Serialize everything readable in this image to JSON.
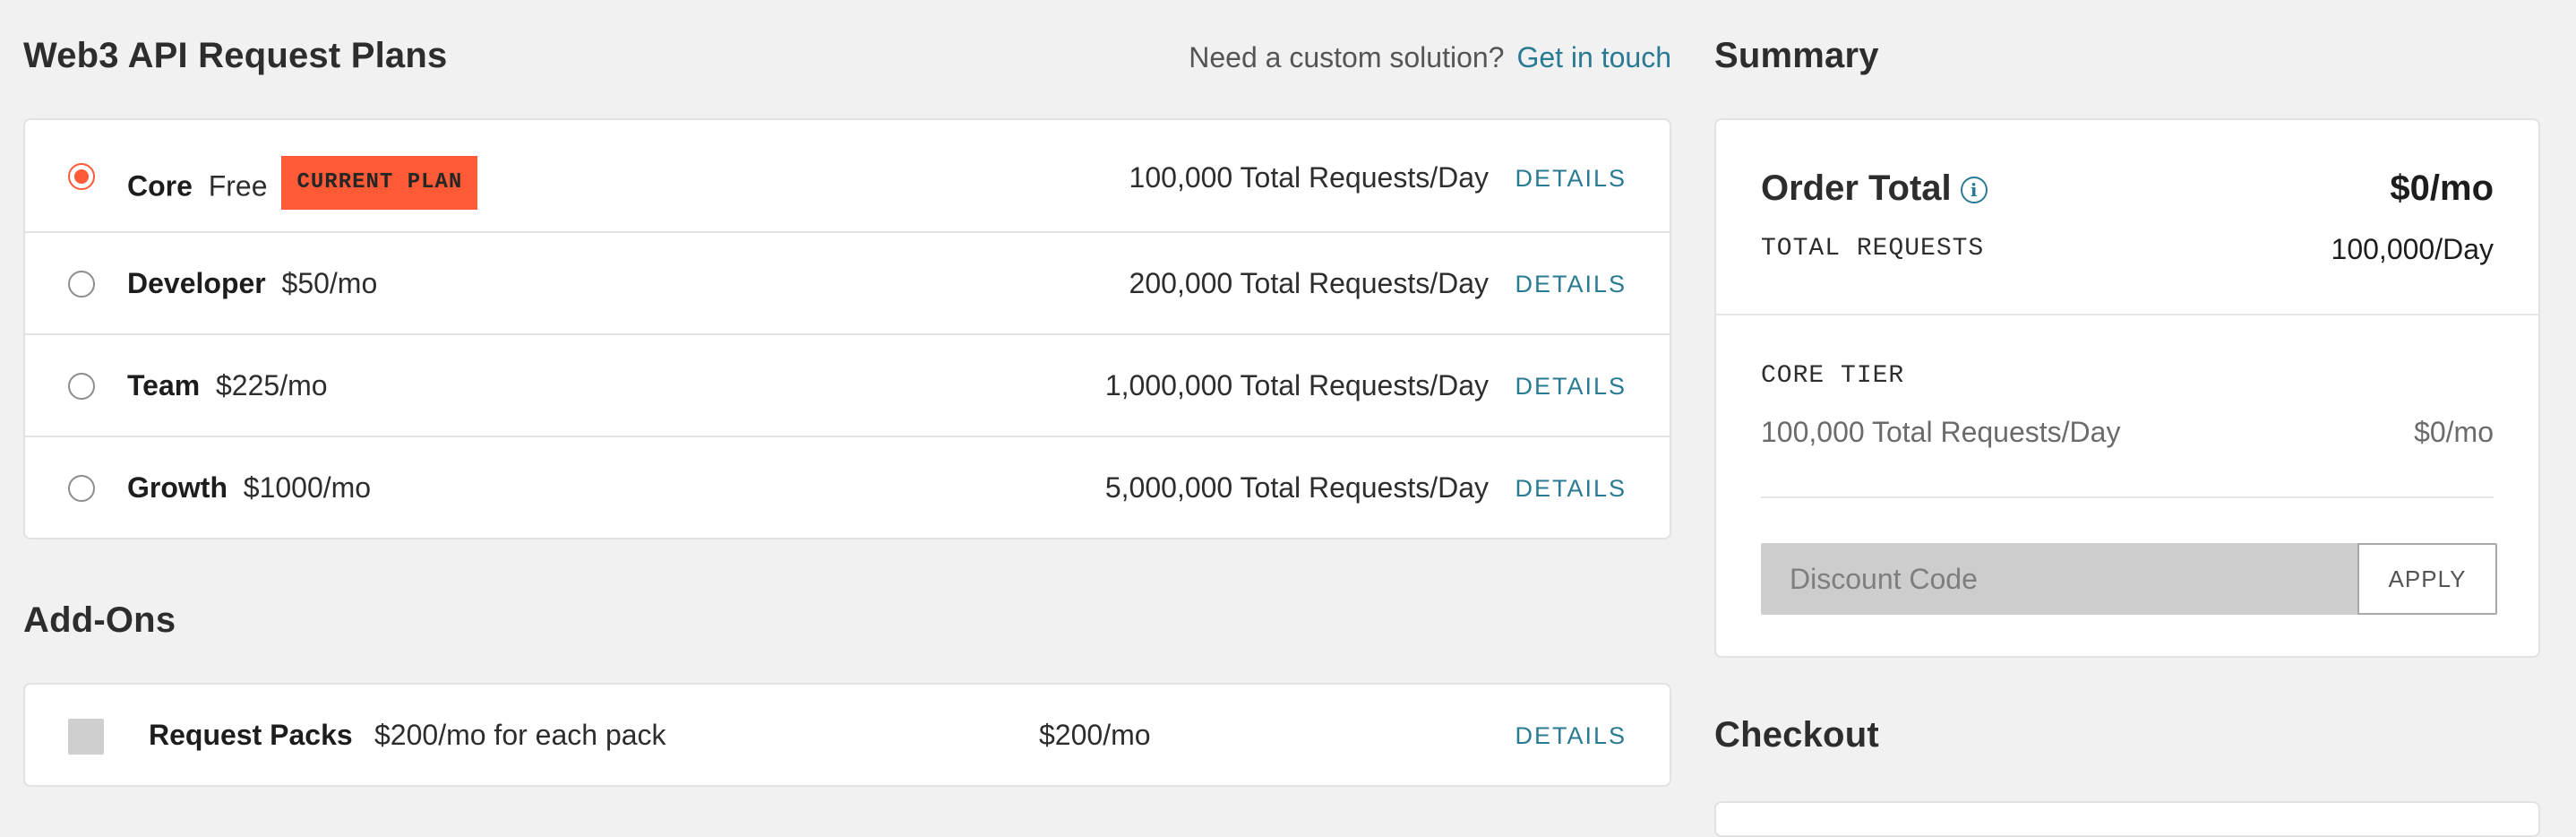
{
  "plans": {
    "title": "Web3 API Request Plans",
    "custom_question": "Need a custom solution?",
    "custom_link": "Get in touch",
    "items": [
      {
        "name": "Core",
        "price": "Free",
        "badge": "CURRENT PLAN",
        "requests": "100,000 Total Requests/Day",
        "details": "DETAILS",
        "selected": true
      },
      {
        "name": "Developer",
        "price": "$50/mo",
        "requests": "200,000 Total Requests/Day",
        "details": "DETAILS",
        "selected": false
      },
      {
        "name": "Team",
        "price": "$225/mo",
        "requests": "1,000,000 Total Requests/Day",
        "details": "DETAILS",
        "selected": false
      },
      {
        "name": "Growth",
        "price": "$1000/mo",
        "requests": "5,000,000 Total Requests/Day",
        "details": "DETAILS",
        "selected": false
      }
    ]
  },
  "addons": {
    "title": "Add-Ons",
    "items": [
      {
        "name": "Request Packs",
        "description": "$200/mo for each pack",
        "price": "$200/mo",
        "details": "DETAILS",
        "checked": false
      }
    ]
  },
  "summary": {
    "title": "Summary",
    "order_total_label": "Order Total",
    "order_total_value": "$0/mo",
    "info_icon": "i",
    "total_requests_label": "TOTAL REQUESTS",
    "total_requests_value": "100,000/Day",
    "tier_label": "CORE TIER",
    "tier_requests": "100,000 Total Requests/Day",
    "tier_price": "$0/mo",
    "discount_placeholder": "Discount Code",
    "apply_label": "APPLY"
  },
  "checkout": {
    "title": "Checkout"
  },
  "colors": {
    "accent": "#ff5a36",
    "link": "#2a7a93",
    "background": "#f1f1f1"
  }
}
